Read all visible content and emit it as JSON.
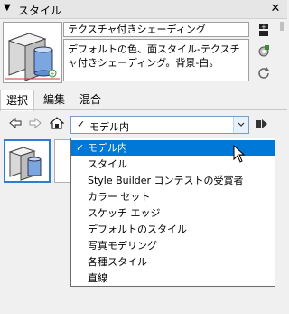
{
  "panel": {
    "title": "スタイル",
    "toggle_icon": "collapse-triangle-icon",
    "close_icon": "close-icon"
  },
  "style_info": {
    "name": "テクスチャ付きシェーディング",
    "description": "デフォルトの色、面スタイル-テクスチャ付きシェーディング。背景-白。"
  },
  "tabs": [
    {
      "label": "選択",
      "active": true
    },
    {
      "label": "編集",
      "active": false
    },
    {
      "label": "混合",
      "active": false
    }
  ],
  "collection_combo": {
    "check": "✓",
    "value": "モデル内"
  },
  "dropdown": {
    "check": "✓",
    "items": [
      {
        "label": "モデル内",
        "checked": true,
        "selected": true
      },
      {
        "label": "スタイル",
        "checked": false,
        "selected": false
      },
      {
        "label": "Style Builder コンテストの受賞者",
        "checked": false,
        "selected": false
      },
      {
        "label": "カラー セット",
        "checked": false,
        "selected": false
      },
      {
        "label": "スケッチ エッジ",
        "checked": false,
        "selected": false
      },
      {
        "label": "デフォルトのスタイル",
        "checked": false,
        "selected": false
      },
      {
        "label": "写真モデリング",
        "checked": false,
        "selected": false
      },
      {
        "label": "各種スタイル",
        "checked": false,
        "selected": false
      },
      {
        "label": "直線",
        "checked": false,
        "selected": false
      }
    ]
  },
  "colors": {
    "selection": "#0078d7",
    "thumb_border": "#2f7bd6"
  }
}
